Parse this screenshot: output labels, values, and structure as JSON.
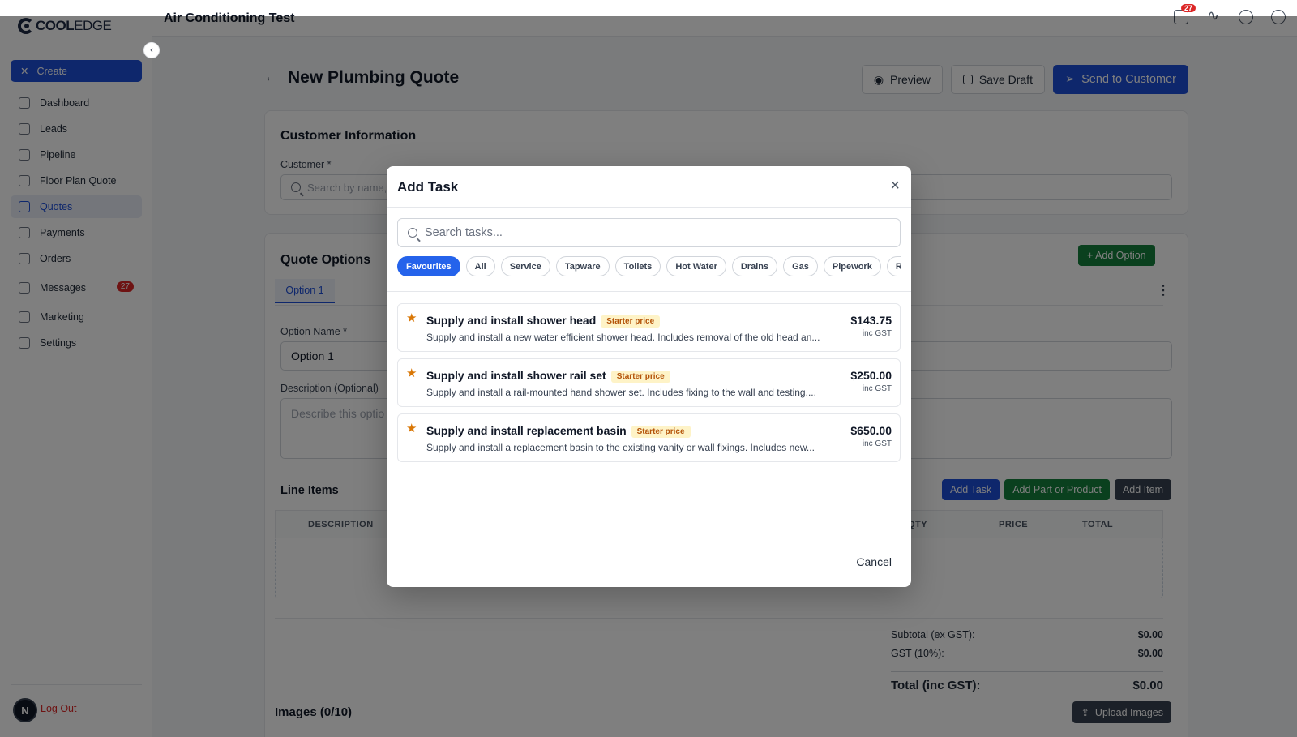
{
  "sidebar": {
    "logo_bold": "COOL",
    "logo_light": "EDGE",
    "create_label": "Create",
    "items": [
      {
        "label": "Dashboard"
      },
      {
        "label": "Leads"
      },
      {
        "label": "Pipeline"
      },
      {
        "label": "Floor Plan Quote"
      },
      {
        "label": "Quotes"
      },
      {
        "label": "Payments"
      },
      {
        "label": "Orders"
      },
      {
        "label": "Messages",
        "badge": "27"
      },
      {
        "label": "Marketing"
      },
      {
        "label": "Settings"
      }
    ],
    "avatar_initial": "N",
    "logout_label": "Log Out"
  },
  "topbar": {
    "title": "Air Conditioning Test",
    "notifications_badge": "27"
  },
  "page": {
    "title": "New Plumbing Quote",
    "preview_label": "Preview",
    "save_draft_label": "Save Draft",
    "send_label": "Send to Customer"
  },
  "customer": {
    "section_title": "Customer Information",
    "customer_label": "Customer *",
    "search_placeholder": "Search by name,"
  },
  "quote_options": {
    "section_title": "Quote Options",
    "add_option_label": "+ Add Option",
    "tab_label": "Option 1",
    "option_name_label": "Option Name *",
    "option_name_value": "Option 1",
    "description_label": "Description (Optional)",
    "description_placeholder": "Describe this optio"
  },
  "line_items": {
    "section_title": "Line Items",
    "add_task_label": "Add Task",
    "add_part_label": "Add Part or Product",
    "add_item_label": "Add Item",
    "columns": {
      "description": "DESCRIPTION",
      "qty": "QTY",
      "price": "PRICE",
      "total": "TOTAL"
    }
  },
  "totals": {
    "subtotal_label": "Subtotal (ex GST):",
    "subtotal_value": "$0.00",
    "gst_label": "GST (10%):",
    "gst_value": "$0.00",
    "total_label": "Total (inc GST):",
    "total_value": "$0.00"
  },
  "images": {
    "section_title": "Images (0/10)",
    "upload_label": "Upload Images"
  },
  "modal": {
    "title": "Add Task",
    "search_placeholder": "Search tasks...",
    "chips": [
      "Favourites",
      "All",
      "Service",
      "Tapware",
      "Toilets",
      "Hot Water",
      "Drains",
      "Gas",
      "Pipework",
      "Roof a"
    ],
    "active_chip": "Favourites",
    "tasks": [
      {
        "name": "Supply and install shower head",
        "tag": "Starter price",
        "description": "Supply and install a new water efficient shower head. Includes removal of the old head an...",
        "price": "$143.75",
        "gst": "inc GST"
      },
      {
        "name": "Supply and install shower rail set",
        "tag": "Starter price",
        "description": "Supply and install a rail-mounted hand shower set. Includes fixing to the wall and testing....",
        "price": "$250.00",
        "gst": "inc GST"
      },
      {
        "name": "Supply and install replacement basin",
        "tag": "Starter price",
        "description": "Supply and install a replacement basin to the existing vanity or wall fixings. Includes new...",
        "price": "$650.00",
        "gst": "inc GST"
      }
    ],
    "cancel_label": "Cancel"
  },
  "colors": {
    "primary": "#1d4ed8",
    "success": "#15803d",
    "danger": "#dc2626",
    "starter_badge_bg": "#fef3c7",
    "starter_badge_text": "#b45309"
  }
}
